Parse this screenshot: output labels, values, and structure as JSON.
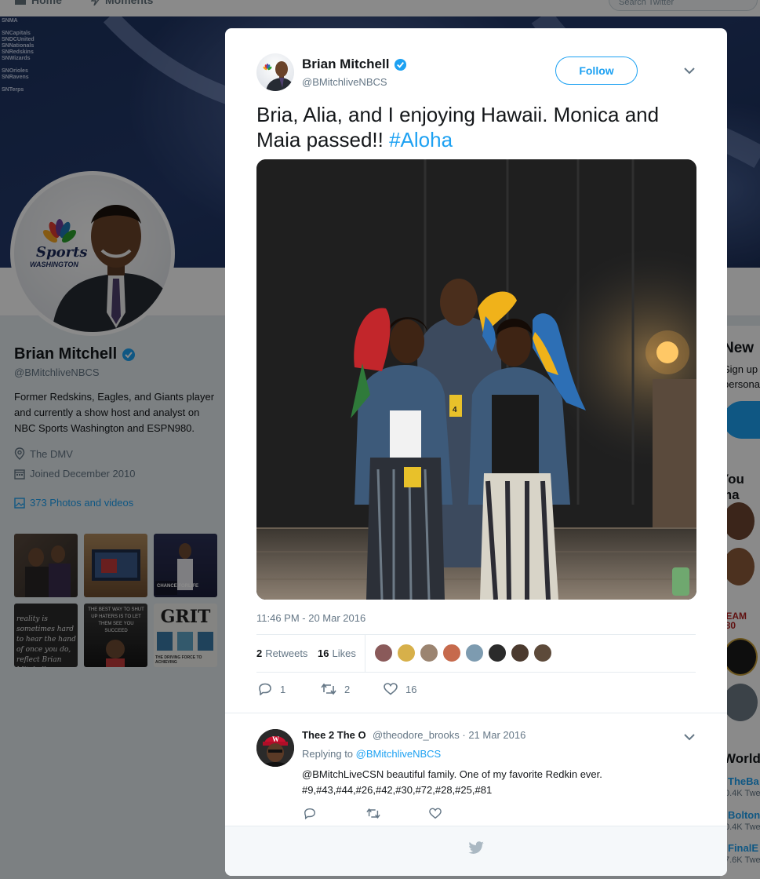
{
  "nav": {
    "home_label": "Home",
    "moments_label": "Moments",
    "search_placeholder": "Search Twitter"
  },
  "banner": {
    "list_top": [
      "SNMA",
      "",
      "SNCapitals",
      "SNDCUnited",
      "SNNationals",
      "SNRedskins",
      "SNWizards"
    ],
    "list_mid": [
      "SNOrioles",
      "SNRavens"
    ],
    "list_bottom": [
      "SNTerps"
    ]
  },
  "profile": {
    "logo_text_1": "Sports",
    "logo_text_2": "WASHINGTON",
    "name": "Brian Mitchell",
    "handle": "@BMitchliveNBCS",
    "bio": "Former Redskins, Eagles, and Giants player and currently a show host and analyst on NBC Sports Washington and ESPN980.",
    "location": "The DMV",
    "joined": "Joined December 2010",
    "photos_link": "373 Photos and videos",
    "thumb_texts": {
      "t4": "reality is sometimes hard to hear the hand of once you do, reflect Brian Mitchell",
      "t5": "THE BEST WAY TO SHUT UP HATERS IS TO LET THEM SEE YOU SUCCEED",
      "t6_title": "GRIT",
      "t6_sub": "THE DRIVING FORCE TO ACHIEVING",
      "t3": "CHANCE FORLIFE"
    }
  },
  "right_column": {
    "new_heading": "New",
    "signup_line1": "Sign up",
    "signup_line2": "persona",
    "you_may": "You ma",
    "team_logo": "E TEAM 980",
    "worldwide": "World",
    "trend1_name": "TheBa",
    "trend1_count": "0.4K Twe",
    "trend2_name": "Bolton",
    "trend2_count": "0.4K Twe",
    "trend3_name": "FinalE",
    "trend3_count": "7.6K Twe"
  },
  "tweet": {
    "author_name": "Brian Mitchell",
    "author_handle": "@BMitchliveNBCS",
    "follow_label": "Follow",
    "text": "Bria, Alia, and I enjoying Hawaii.  Monica and Maia passed!! ",
    "hashtag": "#Aloha",
    "timestamp": "11:46 PM - 20 Mar 2016",
    "retweets_count": "2",
    "retweets_label": "Retweets",
    "likes_count": "16",
    "likes_label": "Likes",
    "reply_count": "1",
    "retweet_count": "2",
    "like_count": "16",
    "badge_text": "4"
  },
  "likers_colors": [
    "#8a5a5a",
    "#d7b04a",
    "#9b8470",
    "#c66a4c",
    "#7d9bb0",
    "#2b2b2b",
    "#4b3a2e",
    "#5d4a3a"
  ],
  "reply": {
    "author_name": "Thee 2 The O",
    "author_handle": "@theodore_brooks · 21 Mar 2016",
    "replying_to_label": "Replying to ",
    "replying_to_handle": "@BMitchliveNBCS",
    "text": "@BMitchLiveCSN beautiful family. One of my favorite Redkin ever. #9,#43,#44,#26,#42,#30,#72,#28,#25,#81"
  },
  "colors": {
    "brand_blue": "#1da1f2",
    "text_dark": "#14171a",
    "text_gray": "#657786"
  }
}
